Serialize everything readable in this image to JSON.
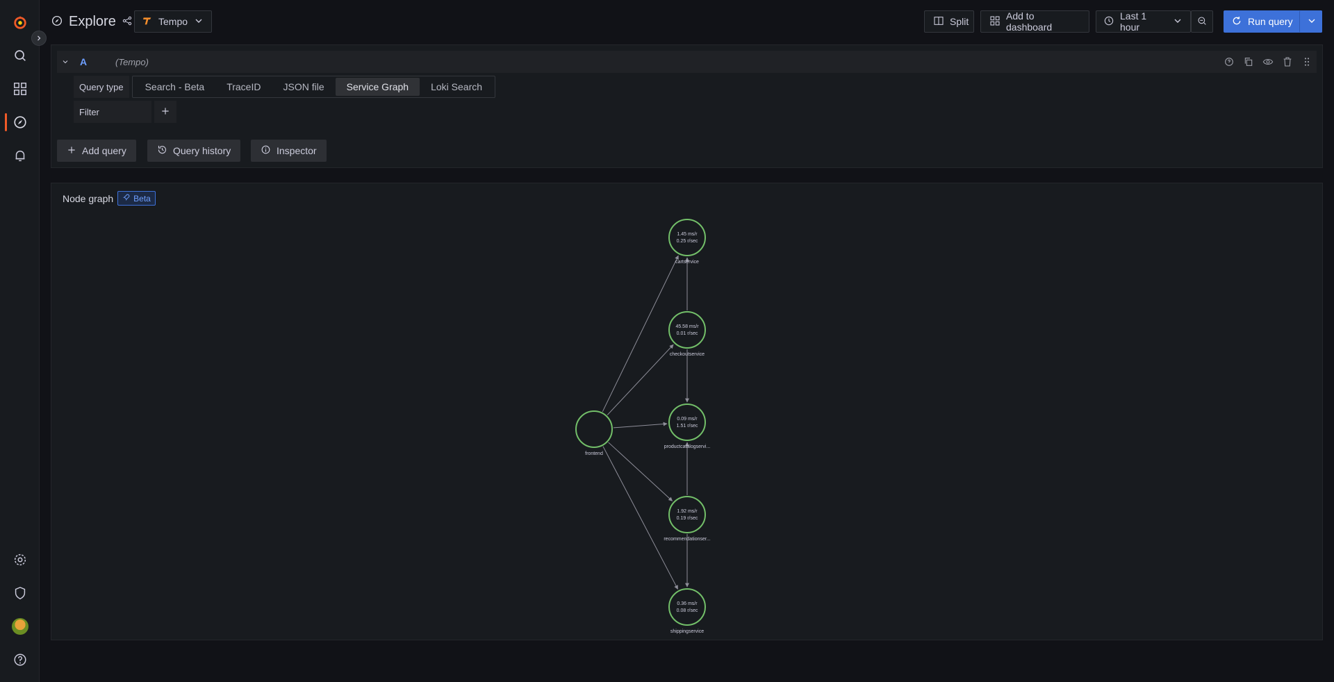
{
  "app": {
    "title": "Explore"
  },
  "datasource": {
    "name": "Tempo"
  },
  "toolbar": {
    "split_label": "Split",
    "add_to_dashboard_label": "Add to dashboard",
    "time_range_label": "Last 1 hour",
    "run_query_label": "Run query"
  },
  "query": {
    "ref_id": "A",
    "datasource_label": "(Tempo)",
    "query_type_label": "Query type",
    "query_types": [
      "Search - Beta",
      "TraceID",
      "JSON file",
      "Service Graph",
      "Loki Search"
    ],
    "active_query_type": "Service Graph",
    "filter_label": "Filter"
  },
  "actions": {
    "add_query_label": "Add query",
    "query_history_label": "Query history",
    "inspector_label": "Inspector"
  },
  "panel": {
    "title": "Node graph",
    "badge": "Beta"
  },
  "node_graph": {
    "node_color": "#73bf69",
    "nodes": [
      {
        "id": "cartservice",
        "label": "cartservice",
        "stat1": "1.45 ms/r",
        "stat2": "0.25 r/sec"
      },
      {
        "id": "checkoutservice",
        "label": "checkoutservice",
        "stat1": "45.58 ms/r",
        "stat2": "0.01 r/sec"
      },
      {
        "id": "frontend",
        "label": "frontend",
        "stat1": "",
        "stat2": ""
      },
      {
        "id": "productcatalogservice",
        "label": "productcatalogservi...",
        "stat1": "0.09 ms/r",
        "stat2": "1.51 r/sec"
      },
      {
        "id": "recommendationservice",
        "label": "recommendationser...",
        "stat1": "1.92 ms/r",
        "stat2": "0.19 r/sec"
      },
      {
        "id": "shippingservice",
        "label": "shippingservice",
        "stat1": "0.36 ms/r",
        "stat2": "0.08 r/sec"
      }
    ],
    "edges": [
      [
        "frontend",
        "cartservice"
      ],
      [
        "frontend",
        "checkoutservice"
      ],
      [
        "frontend",
        "productcatalogservice"
      ],
      [
        "frontend",
        "recommendationservice"
      ],
      [
        "frontend",
        "shippingservice"
      ],
      [
        "checkoutservice",
        "cartservice"
      ],
      [
        "checkoutservice",
        "productcatalogservice"
      ],
      [
        "recommendationservice",
        "productcatalogservice"
      ],
      [
        "recommendationservice",
        "shippingservice"
      ]
    ]
  }
}
